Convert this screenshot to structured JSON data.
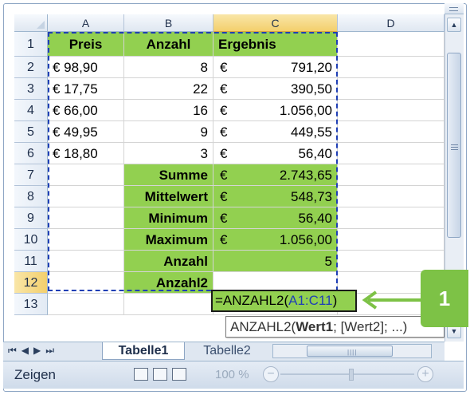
{
  "columns": [
    "A",
    "B",
    "C",
    "D"
  ],
  "rows": [
    "1",
    "2",
    "3",
    "4",
    "5",
    "6",
    "7",
    "8",
    "9",
    "10",
    "11",
    "12",
    "13"
  ],
  "header_row": {
    "a": "Preis",
    "b": "Anzahl",
    "c": "Ergebnis"
  },
  "data_rows": [
    {
      "a": "€ 98,90",
      "b": "8",
      "cur": "€",
      "c": "791,20"
    },
    {
      "a": "€ 17,75",
      "b": "22",
      "cur": "€",
      "c": "390,50"
    },
    {
      "a": "€ 66,00",
      "b": "16",
      "cur": "€",
      "c": "1.056,00"
    },
    {
      "a": "€ 49,95",
      "b": "9",
      "cur": "€",
      "c": "449,55"
    },
    {
      "a": "€ 18,80",
      "b": "3",
      "cur": "€",
      "c": "56,40"
    }
  ],
  "summary_rows": [
    {
      "label": "Summe",
      "cur": "€",
      "value": "2.743,65"
    },
    {
      "label": "Mittelwert",
      "cur": "€",
      "value": "548,73"
    },
    {
      "label": "Minimum",
      "cur": "€",
      "value": "56,40"
    },
    {
      "label": "Maximum",
      "cur": "€",
      "value": "1.056,00"
    },
    {
      "label": "Anzahl",
      "cur": "",
      "value": "5"
    }
  ],
  "formula_row": {
    "label": "Anzahl2",
    "formula_prefix": "=ANZAHL2(",
    "formula_ref": "A1:C11",
    "formula_suffix": ")"
  },
  "tooltip": {
    "func": "ANZAHL2(",
    "arg1": "Wert1",
    "rest": "; [Wert2]; ...)"
  },
  "sheet_tabs": {
    "active": "Tabelle1",
    "inactive": "Tabelle2"
  },
  "status": {
    "mode": "Zeigen",
    "zoom": "100 %",
    "zoom_minus": "−",
    "zoom_plus": "+"
  },
  "annotation": {
    "number": "1"
  },
  "colors": {
    "green_fill": "#92d050",
    "selection_border": "#1f3fb5",
    "callout": "#7dc246"
  }
}
